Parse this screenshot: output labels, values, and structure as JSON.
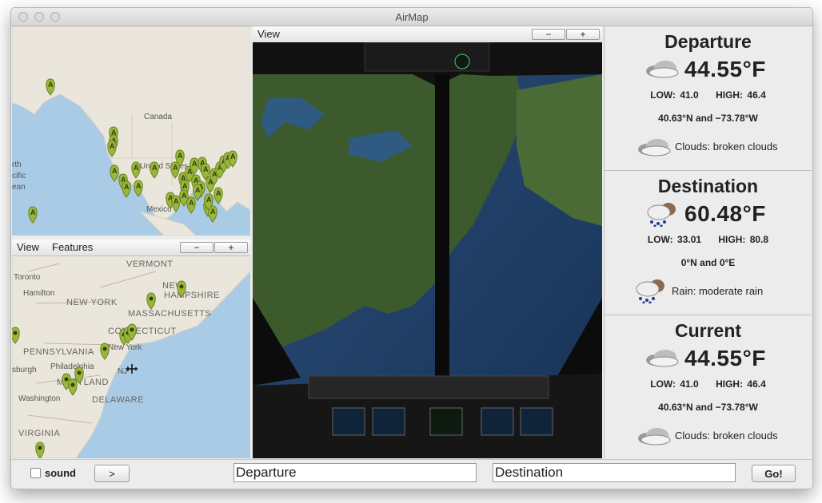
{
  "window": {
    "title": "AirMap"
  },
  "overview_map": {
    "labels": {
      "canada": "Canada",
      "united_states": "United States",
      "mexico": "Mexico",
      "north": "rth",
      "pacific": "cific",
      "ocean": "ean"
    },
    "pin_letter": "A"
  },
  "detail_map": {
    "toolbar": {
      "view_label": "View",
      "features_label": "Features",
      "zoom_out": "−",
      "zoom_in": "+"
    },
    "labels": {
      "vermont": "VERMONT",
      "new_hampshire_1": "NEW",
      "new_hampshire_2": "HAMPSHIRE",
      "massachusetts": "MASSACHUSETTS",
      "toronto": "Toronto",
      "hamilton": "Hamilton",
      "new_york_state": "NEW YORK",
      "connecticut": "CONNECTICUT",
      "pennsylvania": "PENNSYLVANIA",
      "new_york_city": "New York",
      "nj": "NJ",
      "philadelphia": "Philadelphia",
      "maryland": "MARYLAND",
      "washington": "Washington",
      "delaware": "DELAWARE",
      "virginia": "VIRGINIA",
      "burgh": "sburgh"
    }
  },
  "cockpit": {
    "toolbar": {
      "view_label": "View",
      "zoom_out": "−",
      "zoom_in": "+"
    }
  },
  "departure": {
    "title": "Departure",
    "temp": "44.55°F",
    "low_label": "LOW:",
    "low": "41.0",
    "high_label": "HIGH:",
    "high": "46.4",
    "coords": "40.63°N and −73.78°W",
    "condition": "Clouds: broken clouds",
    "icon": "broken-clouds-icon"
  },
  "destination": {
    "title": "Destination",
    "temp": "60.48°F",
    "low_label": "LOW:",
    "low": "33.01",
    "high_label": "HIGH:",
    "high": "80.8",
    "coords": "0°N and 0°E",
    "condition": "Rain: moderate rain",
    "icon": "rain-icon"
  },
  "current": {
    "title": "Current",
    "temp": "44.55°F",
    "low_label": "LOW:",
    "low": "41.0",
    "high_label": "HIGH:",
    "high": "46.4",
    "coords": "40.63°N and −73.78°W",
    "condition": "Clouds: broken clouds",
    "icon": "broken-clouds-icon"
  },
  "bottom_bar": {
    "sound_label": "sound",
    "sound_checked": false,
    "next_label": ">",
    "departure_value": "Departure",
    "destination_value": "Destination",
    "go_label": "Go!"
  }
}
